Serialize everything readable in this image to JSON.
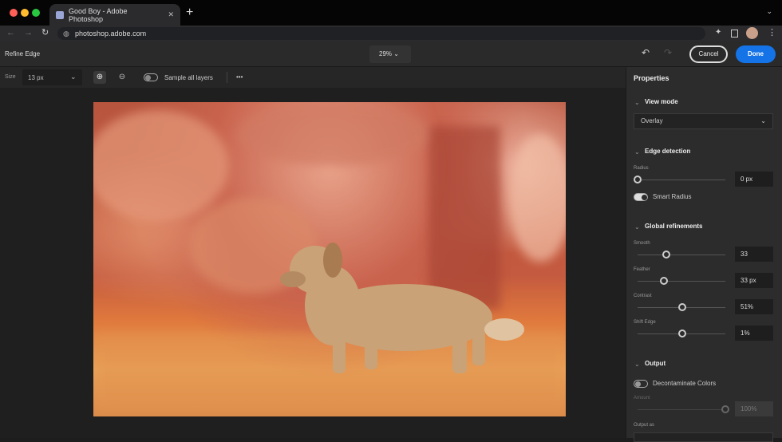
{
  "browser": {
    "tab_title": "Good Boy - Adobe Photoshop",
    "url": "photoshop.adobe.com"
  },
  "header": {
    "title": "Refine Edge",
    "zoom": "29%",
    "cancel_label": "Cancel",
    "done_label": "Done"
  },
  "toolbar": {
    "size_label": "Size",
    "size_value": "13 px",
    "sample_all_layers": "Sample all layers",
    "more": "•••"
  },
  "panel": {
    "title": "Properties",
    "view_mode": {
      "heading": "View mode",
      "value": "Overlay"
    },
    "edge_detection": {
      "heading": "Edge detection",
      "radius_label": "Radius",
      "radius_value": "0 px",
      "radius_level": 0,
      "smart_radius_label": "Smart Radius",
      "smart_radius_on": true
    },
    "global_refinements": {
      "heading": "Global refinements",
      "sliders": [
        {
          "label": "Smooth",
          "value": "33",
          "level": 0.33
        },
        {
          "label": "Feather",
          "value": "33 px",
          "level": 0.3
        },
        {
          "label": "Contrast",
          "value": "51%",
          "level": 0.51
        },
        {
          "label": "Shift Edge",
          "value": "1%",
          "level": 0.505
        }
      ]
    },
    "output": {
      "heading": "Output",
      "decontaminate_label": "Decontaminate Colors",
      "decontaminate_on": false,
      "amount_label": "Amount",
      "amount_value": "100%",
      "amount_level": 1.0,
      "output_as_label": "Output as"
    }
  },
  "colors": {
    "accent": "#1473e6",
    "overlay": "#c9634e"
  }
}
